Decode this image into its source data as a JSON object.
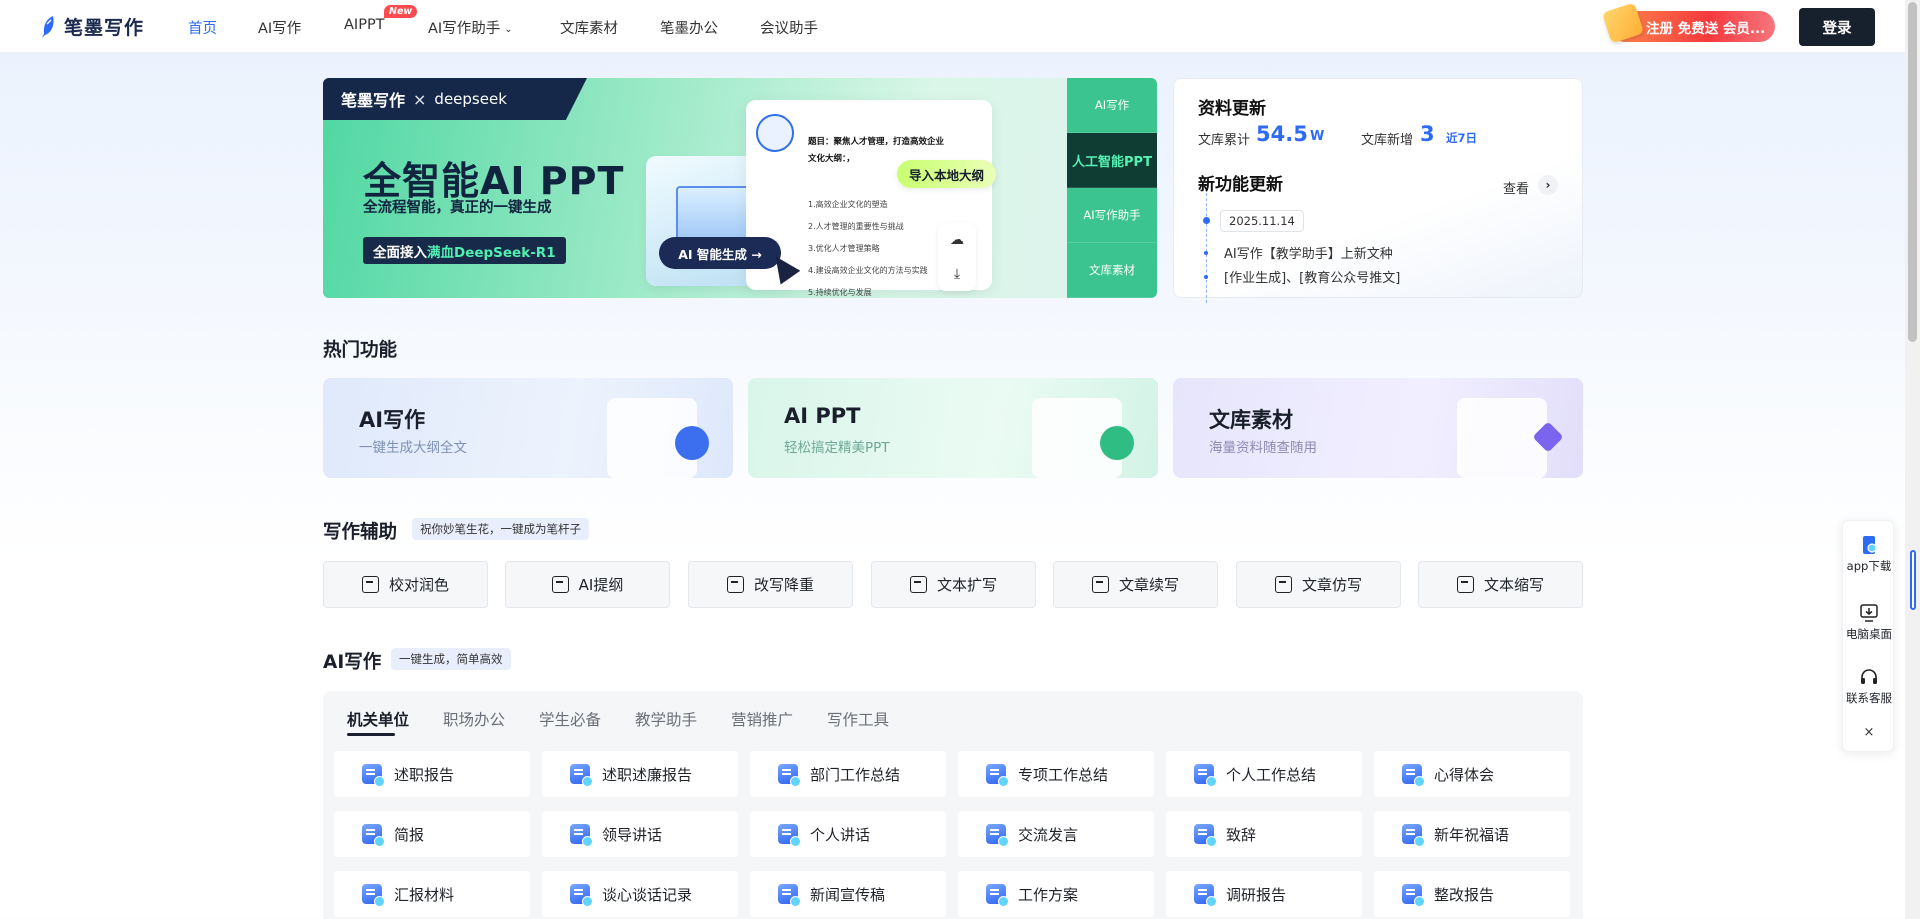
{
  "nav": {
    "brand": "笔墨写作",
    "items": [
      {
        "label": "首页",
        "active": true
      },
      {
        "label": "AI写作"
      },
      {
        "label": "AIPPT"
      },
      {
        "label": "AI写作助手"
      },
      {
        "label": "文库素材"
      },
      {
        "label": "笔墨办公"
      },
      {
        "label": "会议助手"
      }
    ],
    "new_badge": "New",
    "promo": "注册 免费送 会员...",
    "login": "登录"
  },
  "banner": {
    "brand": "笔墨写作",
    "cross": "×",
    "partner": "deepseek",
    "title": "全智能AI PPT",
    "subtitle": "全流程智能，真正的一键生成",
    "chip_prefix": "全面接入",
    "chip_highlight": "满血DeepSeek-R1",
    "doc_heading": "题目：聚焦人才管理，打造高效企业文化大纲：，",
    "doc_lines": [
      "1.高效企业文化的塑造",
      "2.人才管理的重要性与挑战",
      "3.优化人才管理策略",
      "4.建设高效企业文化的方法与实践",
      "5.持续优化与发展"
    ],
    "import_label": "导入本地大纲",
    "ai_button": "AI 智能生成 →",
    "tabs": [
      {
        "label": "AI写作"
      },
      {
        "label": "人工智能PPT",
        "active": true
      },
      {
        "label": "AI写作助手"
      },
      {
        "label": "文库素材"
      }
    ]
  },
  "updates": {
    "title": "资料更新",
    "total_label": "文库累计",
    "total_value": "54.5",
    "total_unit": "W",
    "new_label": "文库新增",
    "new_value": "3",
    "new_period": "近7日",
    "feature_title": "新功能更新",
    "view": "查看",
    "date": "2025.11.14",
    "items": [
      "AI写作【教学助手】上新文种",
      "[作业生成]、[教育公众号推文]"
    ]
  },
  "hot": {
    "title": "热门功能",
    "cards": [
      {
        "title": "AI写作",
        "subtitle": "一键生成大纲全文"
      },
      {
        "title": "AI PPT",
        "subtitle": "轻松搞定精美PPT"
      },
      {
        "title": "文库素材",
        "subtitle": "海量资料随查随用"
      }
    ]
  },
  "assist": {
    "title": "写作辅助",
    "pill": "祝你妙笔生花，一键成为笔杆子",
    "tools": [
      "校对润色",
      "AI提纲",
      "改写降重",
      "文本扩写",
      "文章续写",
      "文章仿写",
      "文本缩写"
    ]
  },
  "aiwrite": {
    "title": "AI写作",
    "pill": "一键生成，简单高效",
    "tabs": [
      "机关单位",
      "职场办公",
      "学生必备",
      "教学助手",
      "营销推广",
      "写作工具"
    ],
    "rows": [
      [
        "述职报告",
        "述职述廉报告",
        "部门工作总结",
        "专项工作总结",
        "个人工作总结",
        "心得体会"
      ],
      [
        "简报",
        "领导讲话",
        "个人讲话",
        "交流发言",
        "致辞",
        "新年祝福语"
      ],
      [
        "汇报材料",
        "谈心谈话记录",
        "新闻宣传稿",
        "工作方案",
        "调研报告",
        "整改报告"
      ]
    ]
  },
  "float": {
    "items": [
      "app下载",
      "电脑桌面",
      "联系客服"
    ],
    "close": "×"
  },
  "colors": {
    "accent": "#2e6bf5",
    "banner_green": "#3bc48f",
    "dark": "#17202d"
  }
}
